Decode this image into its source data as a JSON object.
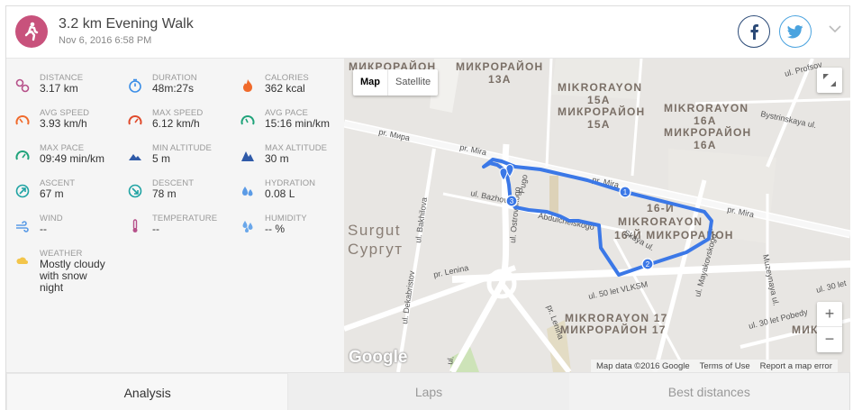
{
  "header": {
    "title": "3.2 km Evening Walk",
    "subtitle": "Nov 6, 2016 6:58 PM",
    "activity_icon": "walking-person-icon",
    "accent": "#c8527c"
  },
  "share": {
    "facebook_icon": "facebook-icon",
    "twitter_icon": "twitter-icon",
    "menu_icon": "chevron-down-icon"
  },
  "stats": [
    {
      "label": "DISTANCE",
      "value": "3.17 km",
      "icon": "route-pin-icon"
    },
    {
      "label": "DURATION",
      "value": "48m:27s",
      "icon": "stopwatch-icon"
    },
    {
      "label": "CALORIES",
      "value": "362 kcal",
      "icon": "flame-icon"
    },
    {
      "label": "AVG SPEED",
      "value": "3.93 km/h",
      "icon": "speedometer-icon"
    },
    {
      "label": "MAX SPEED",
      "value": "6.12 km/h",
      "icon": "speedometer-max-icon"
    },
    {
      "label": "AVG PACE",
      "value": "15:16 min/km",
      "icon": "pace-gauge-icon"
    },
    {
      "label": "MAX PACE",
      "value": "09:49 min/km",
      "icon": "pace-gauge-max-icon"
    },
    {
      "label": "MIN ALTITUDE",
      "value": "5 m",
      "icon": "mountain-low-icon"
    },
    {
      "label": "MAX ALTITUDE",
      "value": "30 m",
      "icon": "mountain-high-icon"
    },
    {
      "label": "ASCENT",
      "value": "67 m",
      "icon": "ascent-icon"
    },
    {
      "label": "DESCENT",
      "value": "78 m",
      "icon": "descent-icon"
    },
    {
      "label": "HYDRATION",
      "value": "0.08 L",
      "icon": "water-drops-icon"
    },
    {
      "label": "WIND",
      "value": "--",
      "icon": "wind-icon"
    },
    {
      "label": "TEMPERATURE",
      "value": "--",
      "icon": "thermometer-icon"
    },
    {
      "label": "HUMIDITY",
      "value": "-- %",
      "icon": "humidity-icon"
    },
    {
      "label": "WEATHER",
      "value": "Mostly cloudy with snow night",
      "icon": "weather-cloud-snow-icon"
    }
  ],
  "map": {
    "type_map": "Map",
    "type_satellite": "Satellite",
    "zoom_in": "+",
    "zoom_out": "−",
    "logo": "Google",
    "attribution": "Map data ©2016 Google",
    "terms": "Terms of Use",
    "report": "Report a map error",
    "route_color": "#3b78e7",
    "labels": [
      "МИКРОРАЙОН",
      "МИКРОРАЙОН",
      "13А",
      "MIKRORAYON",
      "15A",
      "МИКРОРАЙОН",
      "15А",
      "MIKRORAYON",
      "16A",
      "МИКРОРАЙОН",
      "16А",
      "16-Й",
      "MIKRORAYON",
      "16-Й МИКРОРАЙОН",
      "MIKRORAYON 17",
      "МИКРОРАЙОН 17",
      "Surgut",
      "Сургут",
      "pr. Мира",
      "pr. Mira",
      "pr. Mira",
      "pr. Mira",
      "ul. Profsoy",
      "Bystrinskaya ul.",
      "ul. Bazhova",
      "ul. Ostrovskogo",
      "Abdulchelskogo",
      "ul. Bakhilova",
      "ul. Dekabristov",
      "pr. Lenina",
      "pr. Lenina",
      "ul. 50 let VLKSM",
      "ul. Mayakovskogo",
      "Muzeynaya ul.",
      "ul. 30 let Pobedy",
      "ul. 30 let",
      "Skaya ul.",
      "Pugo",
      "ul.",
      "МИКР"
    ],
    "markers": [
      "1",
      "2",
      "3"
    ]
  },
  "tabs": [
    {
      "label": "Analysis",
      "active": true
    },
    {
      "label": "Laps",
      "active": false
    },
    {
      "label": "Best distances",
      "active": false
    }
  ]
}
